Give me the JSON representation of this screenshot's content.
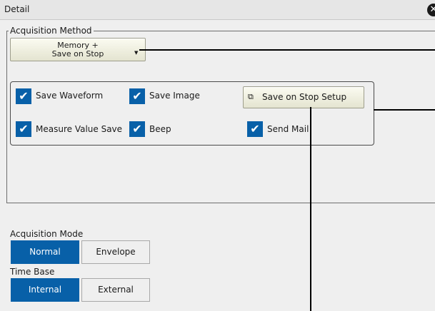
{
  "dialog": {
    "title": "Detail",
    "close_icon": "close-icon"
  },
  "acquisition_method": {
    "legend": "Acquisition Method",
    "method_button": {
      "line1": "Memory +",
      "line2": "Save on Stop",
      "arrow_icon": "chevron-down-icon"
    },
    "options": [
      {
        "label": "Save Waveform",
        "checked": true
      },
      {
        "label": "Save Image",
        "checked": true
      },
      {
        "label": "Measure Value Save",
        "checked": true
      },
      {
        "label": "Beep",
        "checked": true
      },
      {
        "label": "Send Mail",
        "checked": true
      }
    ],
    "setup_button": {
      "label": "Save on Stop Setup",
      "icon": "window-icon"
    }
  },
  "acquisition_mode": {
    "label": "Acquisition Mode",
    "options": [
      "Normal",
      "Envelope"
    ],
    "selected": "Normal"
  },
  "time_base": {
    "label": "Time Base",
    "options": [
      "Internal",
      "External"
    ],
    "selected": "Internal"
  },
  "colors": {
    "accent": "#0860a8",
    "background": "#efefef",
    "button": "#f4f4e4"
  }
}
